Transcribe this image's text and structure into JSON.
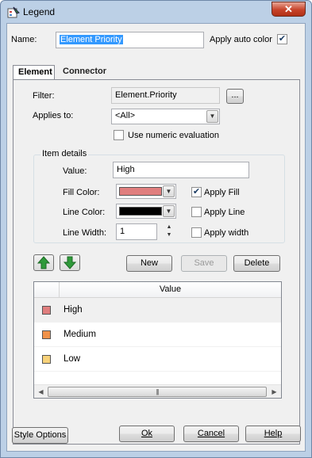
{
  "window": {
    "title": "Legend",
    "close_glyph": "✕"
  },
  "name": {
    "label": "Name:",
    "value": "Element Priority"
  },
  "apply_auto_color": {
    "label": "Apply auto color",
    "checked": true
  },
  "tabs": [
    {
      "label": "Element",
      "active": true
    },
    {
      "label": "Connector",
      "active": false
    }
  ],
  "filter": {
    "label": "Filter:",
    "value": "Element.Priority",
    "browse_label": "..."
  },
  "applies_to": {
    "label": "Applies to:",
    "value": "<All>"
  },
  "numeric_eval": {
    "label": "Use numeric evaluation",
    "checked": false
  },
  "item_details": {
    "title": "Item details",
    "value_label": "Value:",
    "value": "High",
    "fill_color_label": "Fill Color:",
    "fill_color": "#e07e7e",
    "line_color_label": "Line Color:",
    "line_color": "#000000",
    "line_width_label": "Line Width:",
    "line_width": "1",
    "apply_fill": {
      "label": "Apply Fill",
      "checked": true
    },
    "apply_line": {
      "label": "Apply Line",
      "checked": false
    },
    "apply_width": {
      "label": "Apply width",
      "checked": false
    }
  },
  "actions": {
    "new": "New",
    "save": "Save",
    "delete": "Delete"
  },
  "grid": {
    "column_header": "Value",
    "rows": [
      {
        "label": "High",
        "color": "#e07e7e",
        "selected": true
      },
      {
        "label": "Medium",
        "color": "#f0924a",
        "selected": false
      },
      {
        "label": "Low",
        "color": "#f8d27a",
        "selected": false
      }
    ],
    "scroll_grip": "|||"
  },
  "footer": {
    "style_options": "Style Options",
    "ok": "Ok",
    "cancel": "Cancel",
    "help": "Help"
  }
}
